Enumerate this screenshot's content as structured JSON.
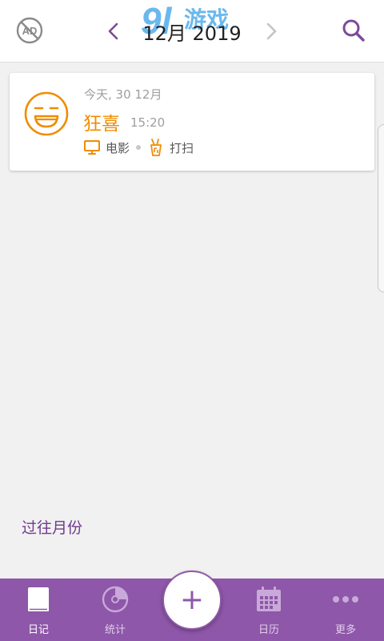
{
  "header": {
    "month_title": "12月 2019",
    "watermark_text": "9游戏",
    "icons": {
      "ad": "no-ads-icon",
      "prev": "chevron-left-icon",
      "next": "chevron-right-icon",
      "search": "search-icon"
    }
  },
  "entry": {
    "date": "今天, 30 12月",
    "mood": "狂喜",
    "time": "15:20",
    "mood_icon": "laughing-face-icon",
    "activities": [
      {
        "label": "电影",
        "icon": "tv-icon"
      },
      {
        "label": "打扫",
        "icon": "cleaning-icon"
      }
    ]
  },
  "past_months_label": "过往月份",
  "bottom_nav": {
    "items": [
      {
        "label": "日记",
        "icon": "book-icon",
        "active": true
      },
      {
        "label": "统计",
        "icon": "stats-disc-icon",
        "active": false
      },
      {
        "label": "日历",
        "icon": "calendar-icon",
        "active": false
      },
      {
        "label": "更多",
        "icon": "more-dots-icon",
        "active": false
      }
    ],
    "add_label": "+"
  },
  "colors": {
    "accent": "#8e57a9",
    "mood_orange": "#f08c00",
    "header_bg": "#ffffff",
    "page_bg": "#f1f1f1",
    "watermark_blue": "#3aa0e8"
  }
}
